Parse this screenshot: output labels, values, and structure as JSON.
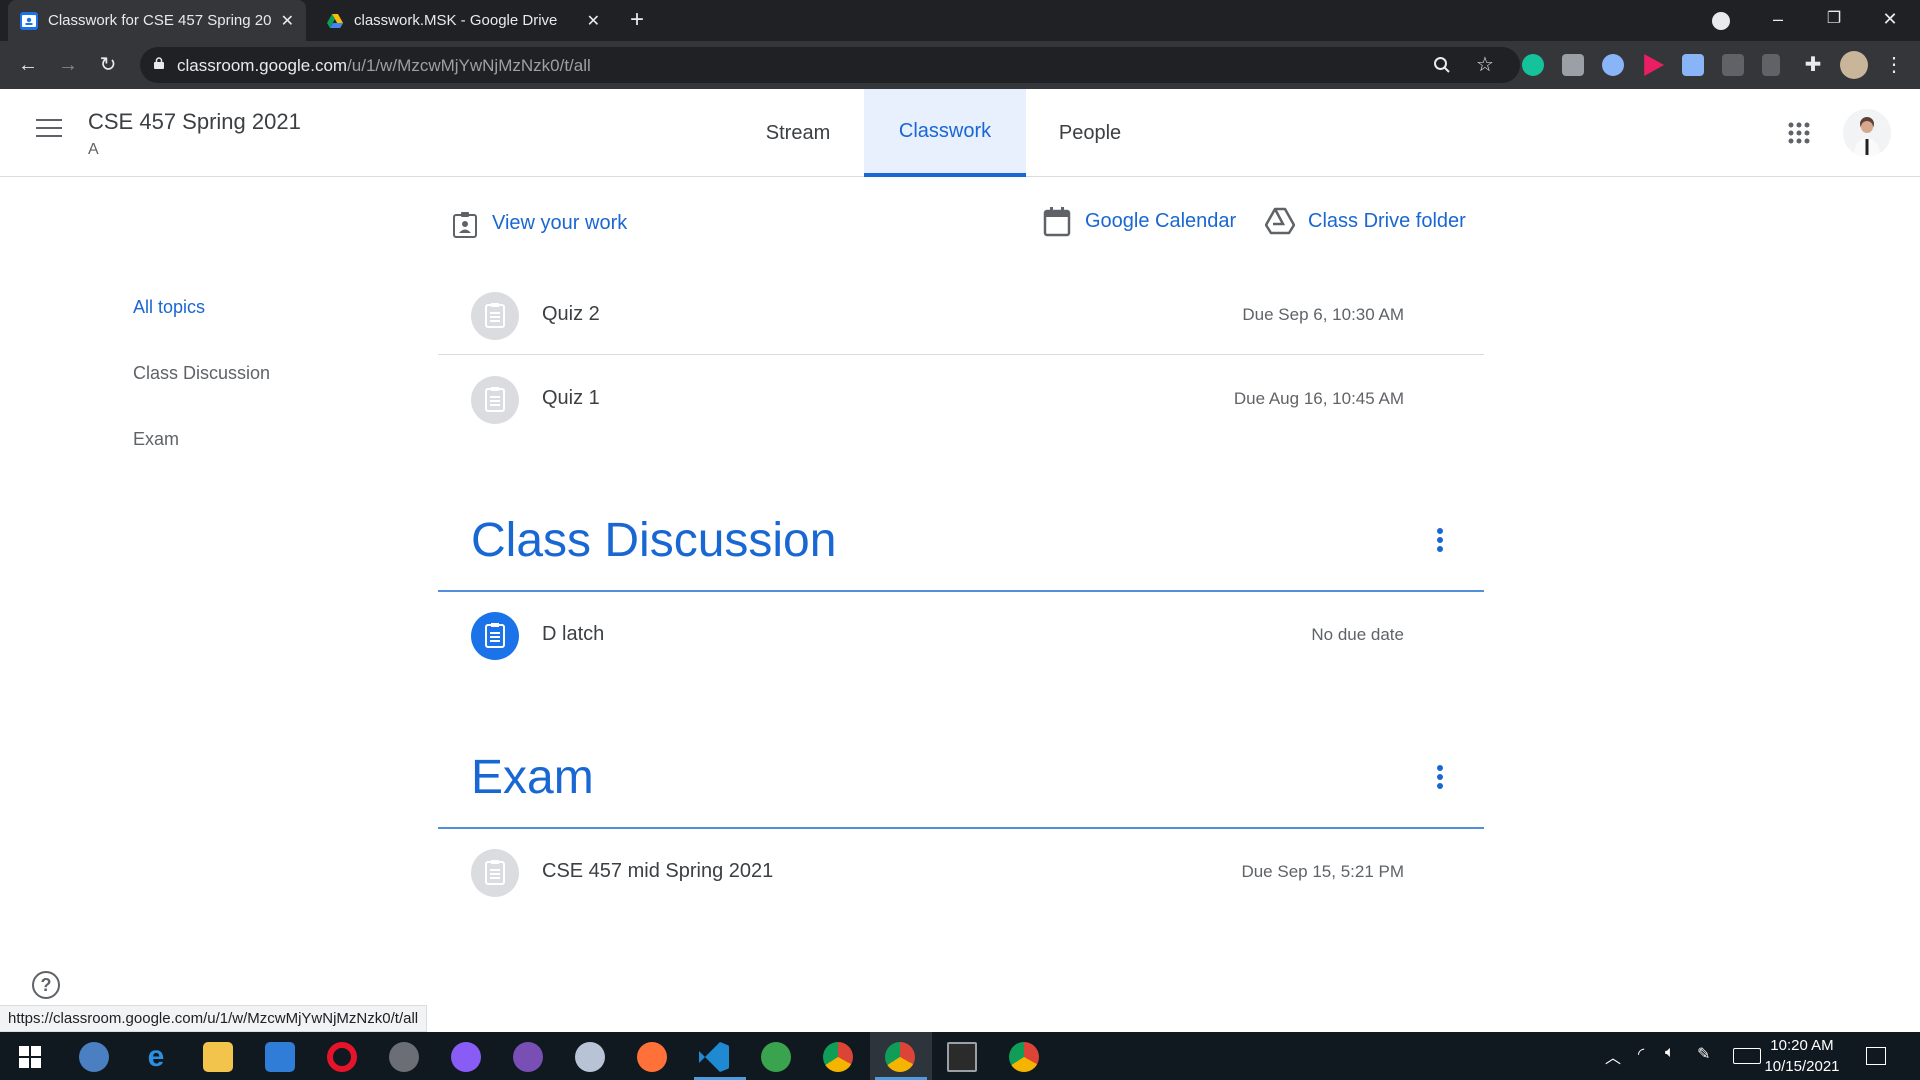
{
  "browser": {
    "tabs": [
      {
        "title": "Classwork for CSE 457 Spring 20…",
        "active": true,
        "favicon": "classroom-icon"
      },
      {
        "title": "classwork.MSK - Google Drive",
        "active": false,
        "favicon": "drive-icon"
      }
    ],
    "url_host": "classroom.google.com",
    "url_path": "/u/1/w/MzcwMjYwNjMzNzk0/t/all"
  },
  "course": {
    "title": "CSE 457 Spring 2021",
    "section": "A"
  },
  "nav_tabs": [
    {
      "label": "Stream",
      "selected": false
    },
    {
      "label": "Classwork",
      "selected": true
    },
    {
      "label": "People",
      "selected": false
    }
  ],
  "actions": {
    "view_work": "View your work",
    "calendar": "Google Calendar",
    "drive": "Class Drive folder"
  },
  "topics_nav": [
    {
      "label": "All topics",
      "selected": true
    },
    {
      "label": "Class Discussion",
      "selected": false
    },
    {
      "label": "Exam",
      "selected": false
    }
  ],
  "untopiced_items": [
    {
      "name": "Quiz 2",
      "due": "Due Sep 6, 10:30 AM"
    },
    {
      "name": "Quiz 1",
      "due": "Due Aug 16, 10:45 AM"
    }
  ],
  "topics": [
    {
      "title": "Class Discussion",
      "items": [
        {
          "name": "D latch",
          "due": "No due date",
          "accent": true
        }
      ]
    },
    {
      "title": "Exam",
      "items": [
        {
          "name": "CSE 457 mid Spring 2021",
          "due": "Due Sep 15, 5:21 PM",
          "accent": false
        }
      ]
    }
  ],
  "status_url": "https://classroom.google.com/u/1/w/MzcwMjYwNjMzNzk0/t/all",
  "clock": {
    "time": "10:20 AM",
    "date": "10/15/2021"
  },
  "colors": {
    "accent": "#1967d2",
    "chrome_dark": "#202124",
    "taskbar": "#101820"
  }
}
